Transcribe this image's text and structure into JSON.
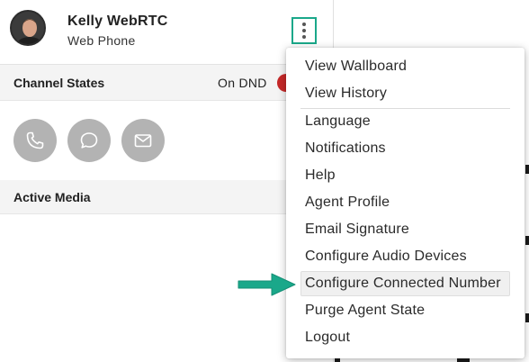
{
  "user": {
    "name": "Kelly WebRTC",
    "subtitle": "Web Phone"
  },
  "channel_states": {
    "title": "Channel States",
    "status": "On DND",
    "status_color": "#c62828",
    "buttons": [
      {
        "icon": "phone-icon"
      },
      {
        "icon": "chat-icon"
      },
      {
        "icon": "email-icon"
      }
    ]
  },
  "active_media": {
    "title": "Active Media"
  },
  "menu": {
    "items": [
      {
        "label": "View Wallboard"
      },
      {
        "label": "View History"
      },
      {
        "label": "Language"
      },
      {
        "label": "Notifications"
      },
      {
        "label": "Help"
      },
      {
        "label": "Agent Profile"
      },
      {
        "label": "Email Signature"
      },
      {
        "label": "Configure Audio Devices"
      },
      {
        "label": "Configure Connected Number"
      },
      {
        "label": "Purge Agent State"
      },
      {
        "label": "Logout"
      }
    ]
  },
  "colors": {
    "accent": "#1aa88a",
    "annotation_arrow": "#1aa88a",
    "channel_button": "#b3b3b3"
  }
}
